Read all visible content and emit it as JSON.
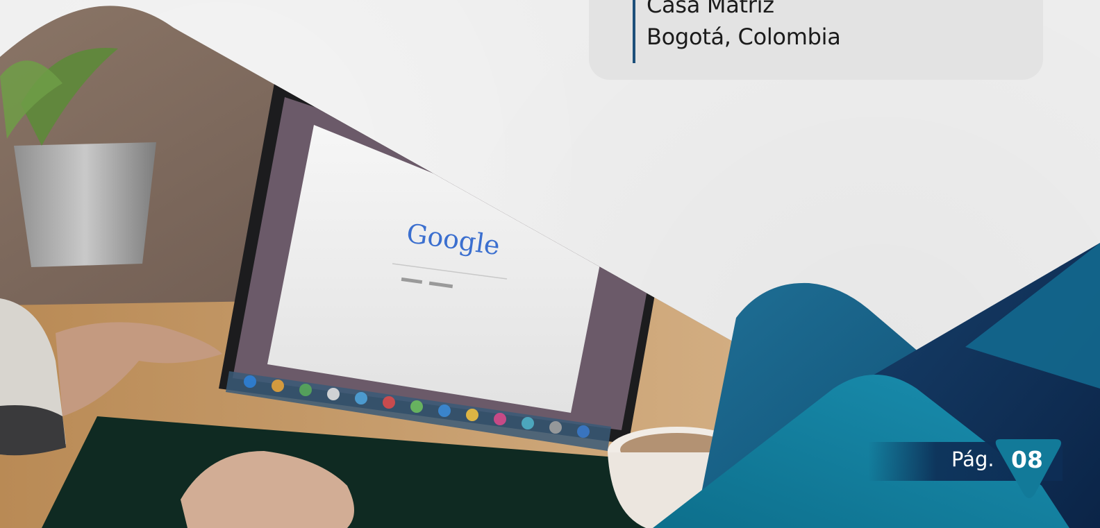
{
  "address": {
    "line1": "Casa Matríz",
    "line2": "Bogotá, Colombia"
  },
  "photo": {
    "screen_logo_text": "Google"
  },
  "footer": {
    "page_label": "Pág.",
    "page_number": "08"
  },
  "colors": {
    "accent_dark_blue": "#0d2d55",
    "accent_teal": "#127a99",
    "accent_line": "#1d4f7a",
    "card_bg": "#e3e3e3"
  }
}
